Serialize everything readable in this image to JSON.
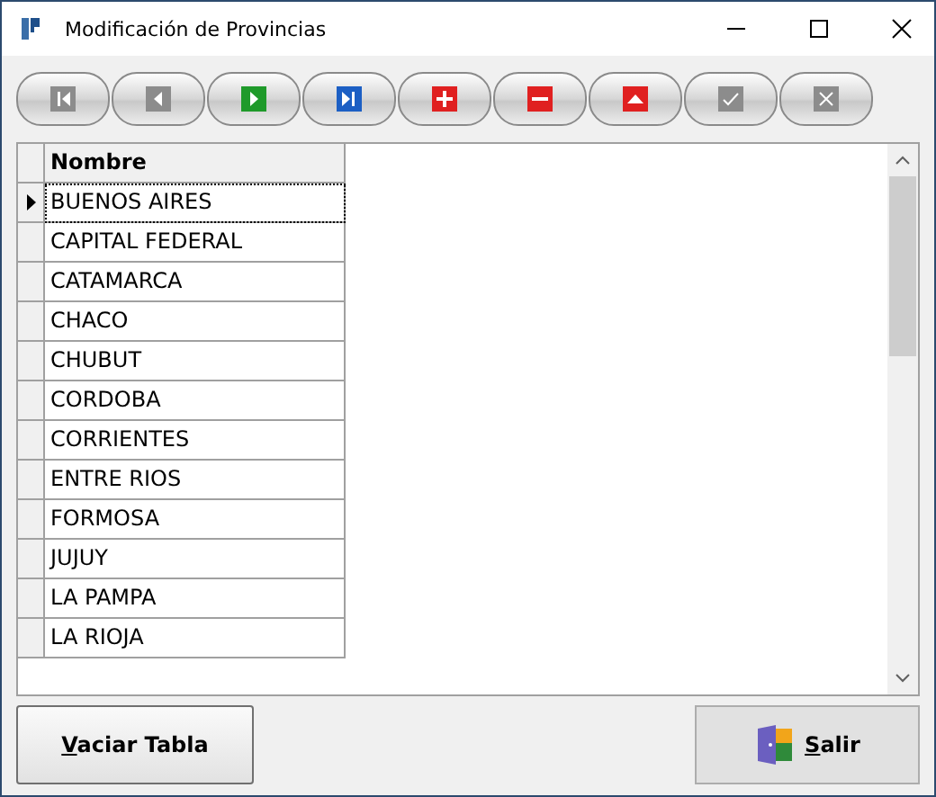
{
  "window": {
    "title": "Modificación de Provincias"
  },
  "toolbar": [
    {
      "kind": "first",
      "disabled": true
    },
    {
      "kind": "prior",
      "disabled": true
    },
    {
      "kind": "next",
      "disabled": false
    },
    {
      "kind": "last",
      "disabled": false
    },
    {
      "kind": "insert",
      "disabled": false
    },
    {
      "kind": "delete",
      "disabled": false
    },
    {
      "kind": "edit",
      "disabled": false
    },
    {
      "kind": "post",
      "disabled": true
    },
    {
      "kind": "cancel",
      "disabled": true
    }
  ],
  "table": {
    "columns": [
      "Nombre"
    ],
    "rows": [
      {
        "cells": [
          "BUENOS AIRES"
        ],
        "selected": true
      },
      {
        "cells": [
          "CAPITAL FEDERAL"
        ],
        "selected": false
      },
      {
        "cells": [
          "CATAMARCA"
        ],
        "selected": false
      },
      {
        "cells": [
          "CHACO"
        ],
        "selected": false
      },
      {
        "cells": [
          "CHUBUT"
        ],
        "selected": false
      },
      {
        "cells": [
          "CORDOBA"
        ],
        "selected": false
      },
      {
        "cells": [
          "CORRIENTES"
        ],
        "selected": false
      },
      {
        "cells": [
          "ENTRE RIOS"
        ],
        "selected": false
      },
      {
        "cells": [
          "FORMOSA"
        ],
        "selected": false
      },
      {
        "cells": [
          "JUJUY"
        ],
        "selected": false
      },
      {
        "cells": [
          "LA PAMPA"
        ],
        "selected": false
      },
      {
        "cells": [
          "LA RIOJA"
        ],
        "selected": false
      }
    ]
  },
  "buttons": [
    {
      "kind": "empty",
      "label": "Vaciar Tabla"
    },
    {
      "kind": "exit",
      "label": "Salir"
    }
  ]
}
